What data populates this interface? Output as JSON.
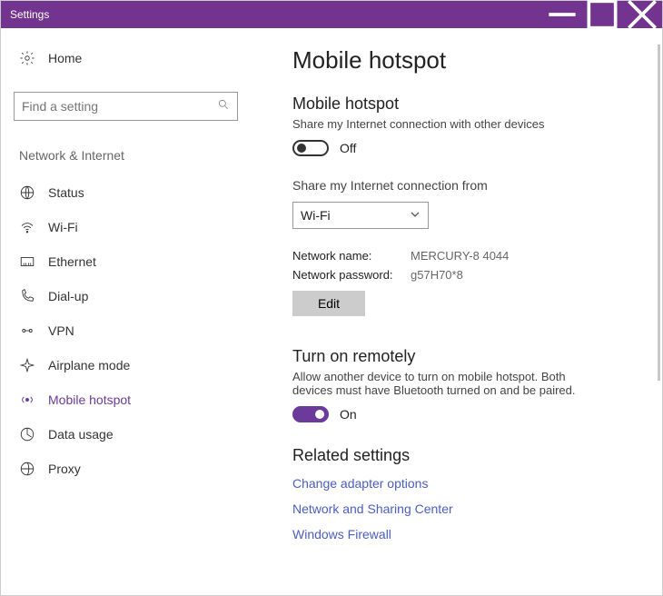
{
  "window": {
    "title": "Settings"
  },
  "sidebar": {
    "home": "Home",
    "search_placeholder": "Find a setting",
    "group": "Network & Internet",
    "items": [
      {
        "label": "Status"
      },
      {
        "label": "Wi-Fi"
      },
      {
        "label": "Ethernet"
      },
      {
        "label": "Dial-up"
      },
      {
        "label": "VPN"
      },
      {
        "label": "Airplane mode"
      },
      {
        "label": "Mobile hotspot"
      },
      {
        "label": "Data usage"
      },
      {
        "label": "Proxy"
      }
    ]
  },
  "main": {
    "title": "Mobile hotspot",
    "hotspot": {
      "heading": "Mobile hotspot",
      "desc": "Share my Internet connection with other devices",
      "state": "Off"
    },
    "share": {
      "label": "Share my Internet connection from",
      "selected": "Wi-Fi"
    },
    "network": {
      "name_label": "Network name:",
      "name_value": "MERCURY-8 4044",
      "password_label": "Network password:",
      "password_value": "g57H70*8",
      "edit": "Edit"
    },
    "remote": {
      "heading": "Turn on remotely",
      "desc": "Allow another device to turn on mobile hotspot. Both devices must have Bluetooth turned on and be paired.",
      "state": "On"
    },
    "related": {
      "heading": "Related settings",
      "links": [
        "Change adapter options",
        "Network and Sharing Center",
        "Windows Firewall"
      ]
    }
  }
}
